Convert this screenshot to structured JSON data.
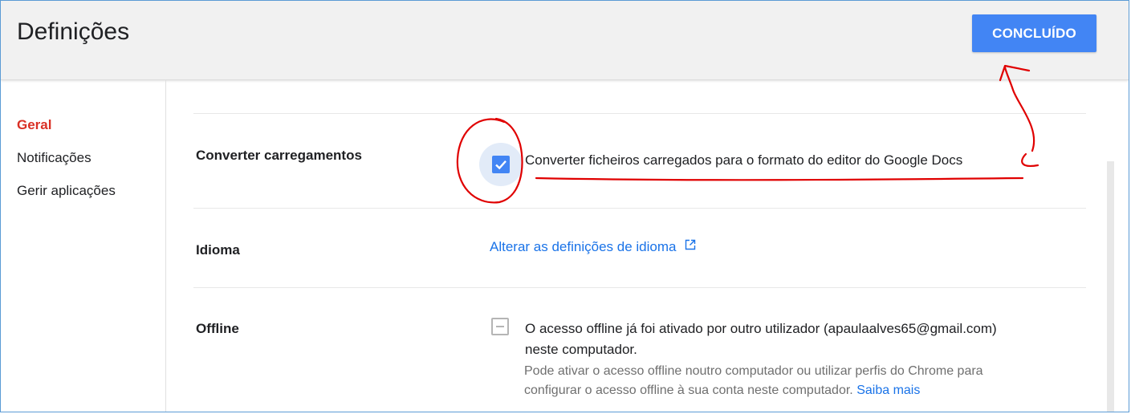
{
  "header": {
    "title": "Definições",
    "done_label": "CONCLUÍDO"
  },
  "sidebar": {
    "items": [
      {
        "label": "Geral",
        "active": true
      },
      {
        "label": "Notificações",
        "active": false
      },
      {
        "label": "Gerir aplicações",
        "active": false
      }
    ]
  },
  "settings": {
    "convert": {
      "label": "Converter carregamentos",
      "checkbox_text": "Converter ficheiros carregados para o formato do editor do Google Docs",
      "checked": true
    },
    "language": {
      "label": "Idioma",
      "link_text": "Alterar as definições de idioma"
    },
    "offline": {
      "label": "Offline",
      "line1": "O acesso offline já foi ativado por outro utilizador (apaulaalves65@gmail.com)",
      "line2": "neste computador.",
      "help1": "Pode ativar o acesso offline noutro computador ou utilizar perfis do Chrome para",
      "help2": "configurar o acesso offline à sua conta neste computador.",
      "learn_more": "Saiba mais",
      "checked": false,
      "disabled": true
    }
  },
  "colors": {
    "accent": "#4285f4",
    "active_nav": "#d93025",
    "annotation": "#e00000"
  },
  "icons": [
    "check-icon",
    "external-link-icon"
  ]
}
